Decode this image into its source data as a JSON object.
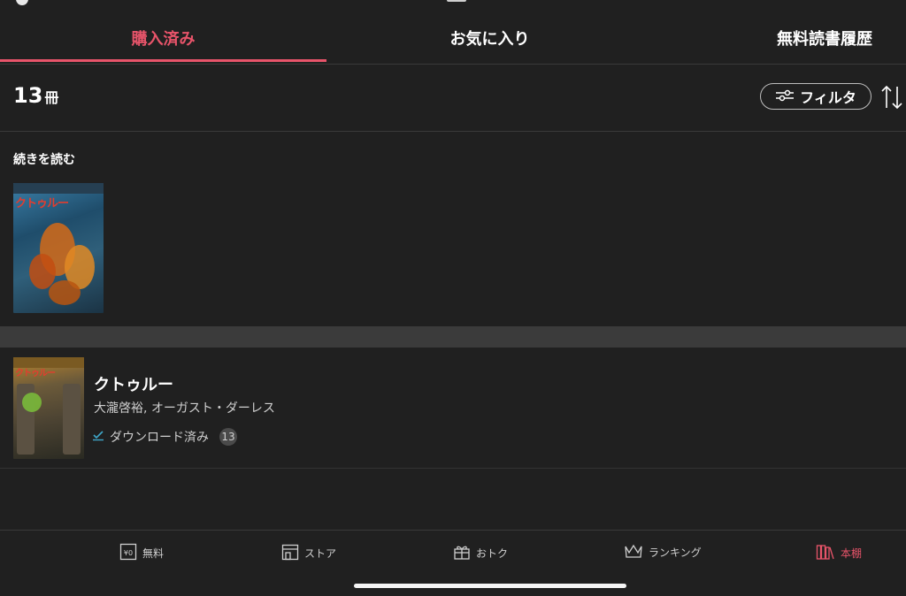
{
  "tabs": [
    {
      "label": "購入済み",
      "active": true
    },
    {
      "label": "お気に入り",
      "active": false
    },
    {
      "label": "無料読書履歴",
      "active": false
    }
  ],
  "count": {
    "value": "13",
    "unit": "冊"
  },
  "filter": {
    "label": "フィルタ",
    "icon": "sliders-icon"
  },
  "sort": {
    "icon": "sort-arrows-icon"
  },
  "continue_reading": {
    "title": "続きを読む",
    "cover_text": "クトゥルー"
  },
  "book": {
    "cover_text": "クトゥルー",
    "title": "クトゥルー",
    "authors": "大瀧啓裕, オーガスト・ダーレス",
    "status": "ダウンロード済み",
    "count": "13"
  },
  "bottom_nav": [
    {
      "label": "無料",
      "icon": "yen-box-icon",
      "active": false
    },
    {
      "label": "ストア",
      "icon": "store-icon",
      "active": false
    },
    {
      "label": "おトク",
      "icon": "gift-icon",
      "active": false
    },
    {
      "label": "ランキング",
      "icon": "crown-icon",
      "active": false
    },
    {
      "label": "本棚",
      "icon": "bookshelf-icon",
      "active": true
    }
  ],
  "colors": {
    "accent": "#e8546a",
    "background": "#202020",
    "divider_band": "#3b3b3b"
  }
}
